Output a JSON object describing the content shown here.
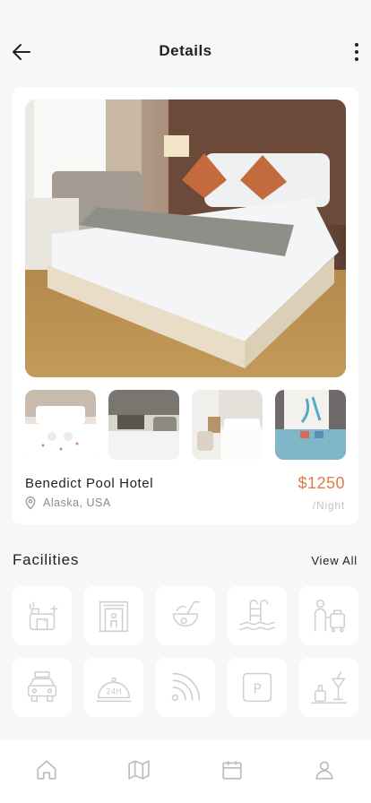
{
  "header": {
    "title": "Details",
    "back_icon": "arrow-left-icon",
    "menu_icon": "more-vertical-icon"
  },
  "hotel": {
    "name": "Benedict Pool Hotel",
    "location": "Alaska, USA",
    "location_icon": "map-pin-icon",
    "price": "$1250",
    "price_unit": "/Night",
    "price_color": "#e07a4a"
  },
  "gallery": {
    "main_photo": "hotel-bedroom-photo",
    "thumbnails": [
      "bed-with-towel-swans-photo",
      "bed-with-desk-photo",
      "bright-bedroom-photo",
      "blue-bedroom-photo"
    ]
  },
  "facilities": {
    "title": "Facilities",
    "view_all": "View All",
    "items": [
      {
        "icon": "kitchen-icon"
      },
      {
        "icon": "elevator-icon"
      },
      {
        "icon": "coconut-drink-icon"
      },
      {
        "icon": "swimming-pool-icon"
      },
      {
        "icon": "bellboy-luggage-icon"
      },
      {
        "icon": "taxi-icon"
      },
      {
        "icon": "room-service-24h-icon"
      },
      {
        "icon": "wifi-icon"
      },
      {
        "icon": "parking-icon"
      },
      {
        "icon": "bar-drinks-icon"
      }
    ]
  },
  "tabbar": {
    "items": [
      {
        "icon": "home-icon"
      },
      {
        "icon": "map-icon"
      },
      {
        "icon": "calendar-icon"
      },
      {
        "icon": "profile-icon"
      }
    ]
  }
}
